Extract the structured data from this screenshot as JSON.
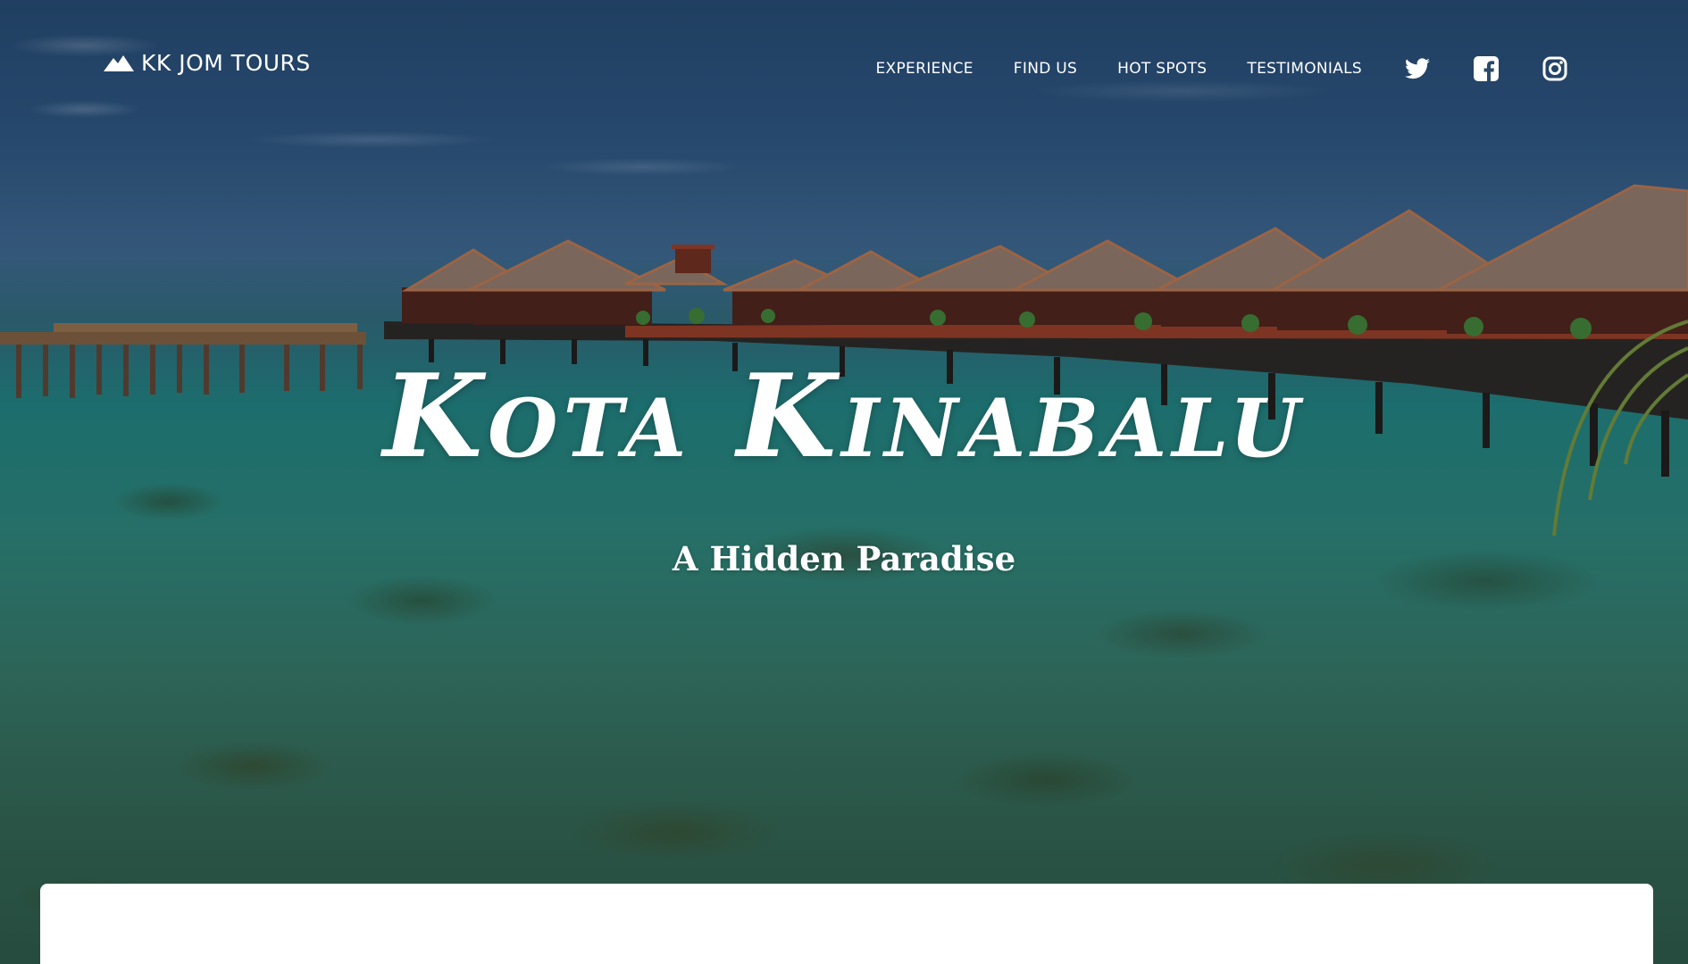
{
  "brand": {
    "name": "KK JOM TOURS",
    "icon": "mountain-icon"
  },
  "nav": {
    "links": [
      "EXPERIENCE",
      "FIND US",
      "HOT SPOTS",
      "TESTIMONIALS"
    ],
    "social": [
      {
        "name": "twitter",
        "icon": "twitter-icon"
      },
      {
        "name": "facebook",
        "icon": "facebook-icon"
      },
      {
        "name": "instagram",
        "icon": "instagram-icon"
      }
    ]
  },
  "hero": {
    "title": "Kota Kinabalu",
    "subtitle": "A Hidden Paradise"
  },
  "colors": {
    "text": "#ffffff",
    "sky": "#24466b",
    "water": "#1f7a78",
    "roof": "#8a7262",
    "card": "#ffffff"
  }
}
